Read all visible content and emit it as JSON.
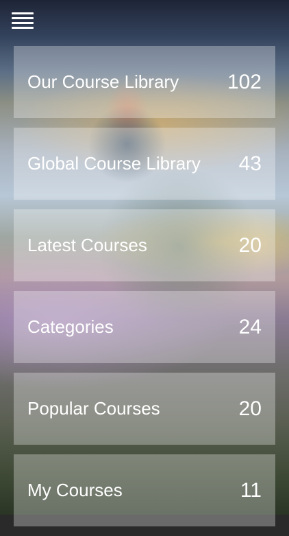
{
  "header": {
    "menu_icon": "hamburger-menu-icon"
  },
  "menu": {
    "items": [
      {
        "label": "Our Course Library",
        "count": "102"
      },
      {
        "label": "Global Course Library",
        "count": "43"
      },
      {
        "label": "Latest Courses",
        "count": "20"
      },
      {
        "label": "Categories",
        "count": "24"
      },
      {
        "label": "Popular Courses",
        "count": "20"
      },
      {
        "label": "My Courses",
        "count": "11"
      }
    ]
  },
  "colors": {
    "text": "#ffffff",
    "tile_overlay": "rgba(255,255,255,0.30)"
  }
}
